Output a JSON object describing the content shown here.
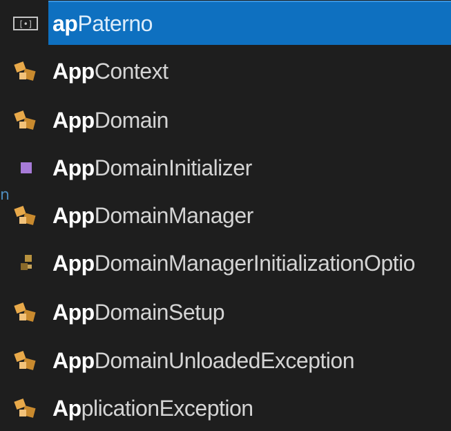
{
  "completion_list": {
    "items": [
      {
        "match": "ap",
        "rest": "Paterno",
        "icon": "snippet-icon",
        "selected": true
      },
      {
        "match": "App",
        "rest": "Context",
        "icon": "class-icon",
        "selected": false
      },
      {
        "match": "App",
        "rest": "Domain",
        "icon": "class-icon",
        "selected": false
      },
      {
        "match": "App",
        "rest": "DomainInitializer",
        "icon": "delegate-icon",
        "selected": false
      },
      {
        "match": "App",
        "rest": "DomainManager",
        "icon": "class-icon",
        "selected": false
      },
      {
        "match": "App",
        "rest": "DomainManagerInitializationOptio",
        "icon": "enum-icon",
        "selected": false
      },
      {
        "match": "App",
        "rest": "DomainSetup",
        "icon": "class-icon",
        "selected": false
      },
      {
        "match": "App",
        "rest": "DomainUnloadedException",
        "icon": "class-icon",
        "selected": false
      },
      {
        "match": "Ap",
        "rest": "plicationException",
        "icon": "class-icon",
        "selected": false
      }
    ]
  },
  "colors": {
    "background": "#1e1e1e",
    "selection": "#0e70c0",
    "class_icon": "#e8a94a",
    "delegate_icon": "#a77bd8"
  }
}
